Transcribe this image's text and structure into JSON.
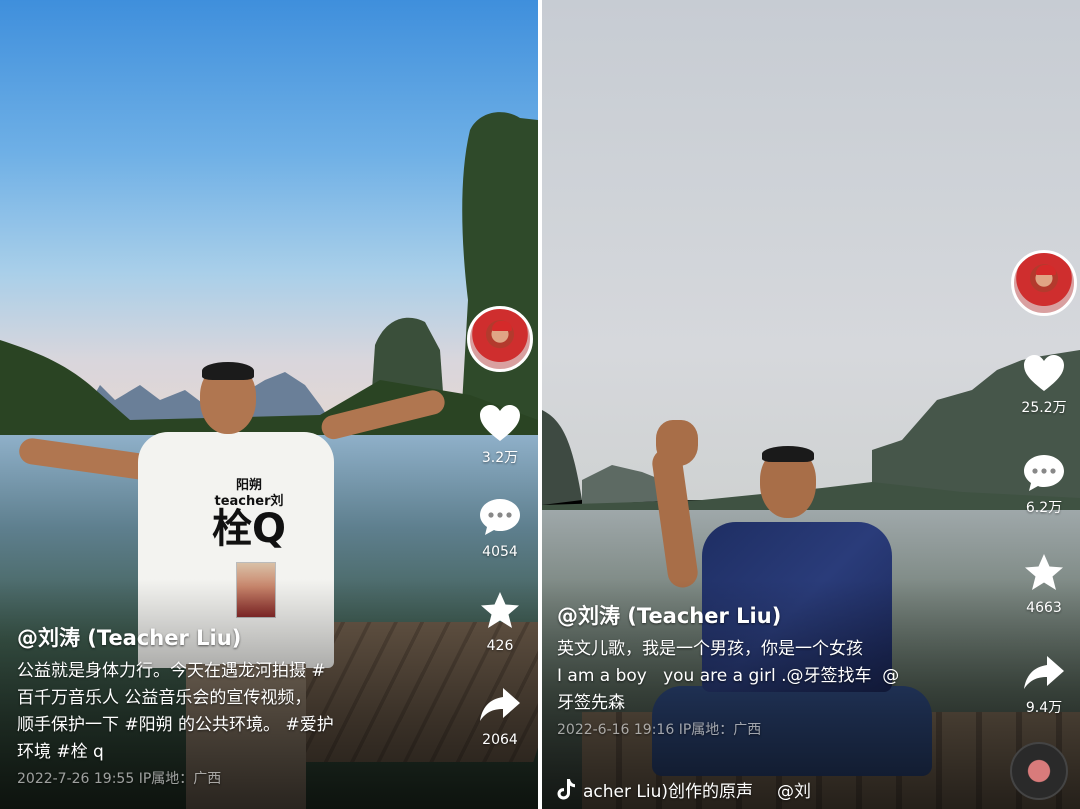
{
  "left_post": {
    "author": "@刘涛 (Teacher Liu)",
    "description": [
      "公益就是身体力行。今天在遇龙河拍摄 #",
      "百千万音乐人 公益音乐会的宣传视频，",
      "顺手保护一下 #阳朔 的公共环境。 #爱护",
      "环境 #栓 q"
    ],
    "meta": "2022-7-26 19:55  IP属地：广西",
    "shirt_print_small": "阳朔\nteacher刘",
    "shirt_print_big": "栓Q",
    "actions": {
      "like_count": "3.2万",
      "comment_count": "4054",
      "favorite_count": "426",
      "share_count": "2064"
    }
  },
  "right_post": {
    "author": "@刘涛 (Teacher Liu)",
    "description": [
      "英文儿歌，我是一个男孩，你是一个女孩",
      "I am a boy   you are a girl .@牙签找车  @",
      "牙签先森"
    ],
    "meta": "2022-6-16 19:16  IP属地：广西",
    "music": "acher Liu)创作的原声",
    "music_extra": "@刘",
    "actions": {
      "like_count": "25.2万",
      "comment_count": "6.2万",
      "favorite_count": "4663",
      "share_count": "9.4万"
    }
  },
  "icons": {
    "like": "heart-icon",
    "comment": "comment-bubble-icon",
    "favorite": "star-icon",
    "share": "share-arrow-icon",
    "music": "tiktok-note-icon"
  },
  "colors": {
    "icon": "#ffffff",
    "meta_text": "rgba(255,255,255,0.6)"
  }
}
